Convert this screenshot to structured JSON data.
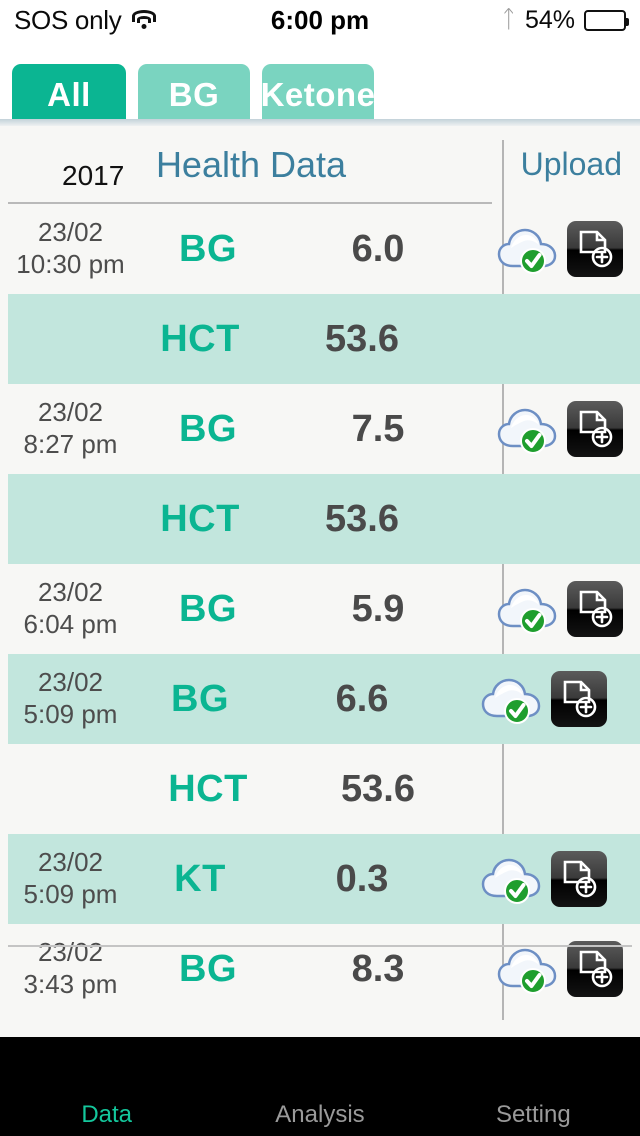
{
  "statusbar": {
    "carrier": "SOS only",
    "wifi_icon": "wifi-icon",
    "time": "6:00 pm",
    "bluetooth_icon": "bluetooth-icon",
    "battery_percent": "54%",
    "battery_level": 54
  },
  "tabs": [
    {
      "label": "All",
      "active": true
    },
    {
      "label": "BG",
      "active": false
    },
    {
      "label": "Ketone",
      "active": false
    }
  ],
  "header": {
    "year": "2017",
    "title": "Health Data",
    "upload": "Upload"
  },
  "rows": [
    {
      "date": "23/02",
      "time": "10:30 pm",
      "type": "BG",
      "value": "6.0",
      "alt": false,
      "icons": true
    },
    {
      "date": "",
      "time": "",
      "type": "HCT",
      "value": "53.6",
      "alt": true,
      "icons": false
    },
    {
      "date": "23/02",
      "time": "8:27 pm",
      "type": "BG",
      "value": "7.5",
      "alt": false,
      "icons": true
    },
    {
      "date": "",
      "time": "",
      "type": "HCT",
      "value": "53.6",
      "alt": true,
      "icons": false
    },
    {
      "date": "23/02",
      "time": "6:04 pm",
      "type": "BG",
      "value": "5.9",
      "alt": false,
      "icons": true
    },
    {
      "date": "23/02",
      "time": "5:09 pm",
      "type": "BG",
      "value": "6.6",
      "alt": true,
      "icons": true
    },
    {
      "date": "",
      "time": "",
      "type": "HCT",
      "value": "53.6",
      "alt": false,
      "icons": false
    },
    {
      "date": "23/02",
      "time": "5:09 pm",
      "type": "KT",
      "value": "0.3",
      "alt": true,
      "icons": true
    },
    {
      "date": "23/02",
      "time": "3:43 pm",
      "type": "BG",
      "value": "8.3",
      "alt": false,
      "icons": true
    }
  ],
  "row_icons": {
    "cloud": "cloud-uploaded-icon",
    "doc_add": "document-add-icon"
  },
  "nav": [
    {
      "label": "Data",
      "icon": "clipboard-icon",
      "active": true
    },
    {
      "label": "Analysis",
      "icon": "chart-icon",
      "active": false
    },
    {
      "label": "Setting",
      "icon": "gears-icon",
      "active": false
    }
  ],
  "colors": {
    "accent_teal": "#0bb592",
    "tab_idle": "#7ad4c0",
    "row_alt": "#c2e6dd",
    "header_blue": "#3c7f9e",
    "value_gray": "#4a4a4a",
    "nav_bg": "#000000"
  }
}
